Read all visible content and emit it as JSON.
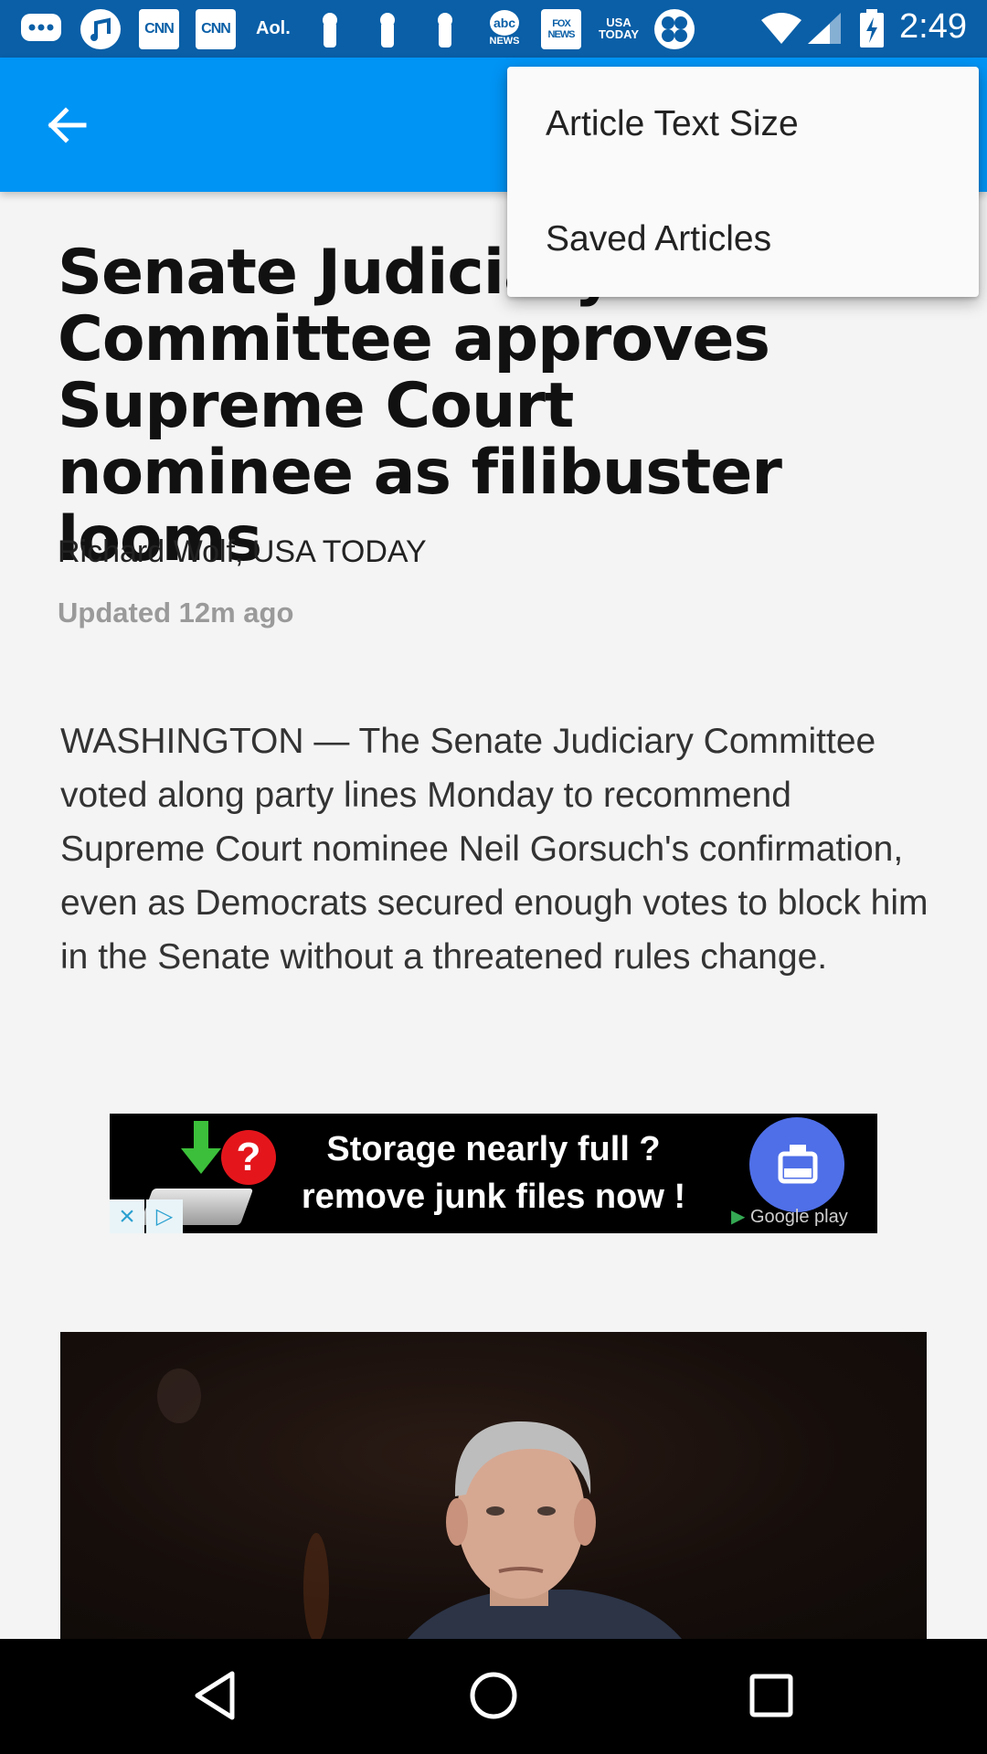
{
  "status_bar": {
    "time": "2:49",
    "notification_icons": [
      "messages-icon",
      "music-app-icon",
      "cnn-icon",
      "cnn-icon",
      "aol-icon",
      "keyhole-icon",
      "keyhole-icon",
      "keyhole-icon",
      "abc-news-icon",
      "fox-news-icon",
      "usa-today-icon",
      "app-icon"
    ],
    "icon_labels": {
      "cnn": "CNN",
      "aol": "Aol.",
      "abc": "abc",
      "abc_sub": "NEWS",
      "fox": "FOX NEWS",
      "usa": "USA TODAY"
    },
    "system_icons": [
      "wifi-icon",
      "cell-signal-icon",
      "battery-charging-icon"
    ]
  },
  "app_bar": {
    "back_icon": "arrow-back-icon",
    "color": "#0094f5"
  },
  "overflow_menu": {
    "items": [
      {
        "label": "Article Text Size"
      },
      {
        "label": "Saved Articles"
      }
    ]
  },
  "article": {
    "headline": "Senate Judiciary Committee approves Supreme Court nominee as filibuster looms",
    "byline": "Richard Wolf, USA TODAY",
    "updated": "Updated 12m ago",
    "body": "WASHINGTON — The Senate Judiciary Committee voted along party lines Monday to recommend Supreme Court nominee Neil Gorsuch's confirmation, even as Democrats secured enough votes to block him in the Senate without a threatened rules change.",
    "image_alt": "Neil Gorsuch"
  },
  "ad": {
    "line1": "Storage nearly full ?",
    "line2": "remove junk files now !",
    "store_badge": "Google play",
    "close_symbol": "×",
    "adchoices_symbol": "▷"
  },
  "nav_bar": {
    "buttons": [
      "back-triangle-icon",
      "home-circle-icon",
      "recents-square-icon"
    ]
  }
}
